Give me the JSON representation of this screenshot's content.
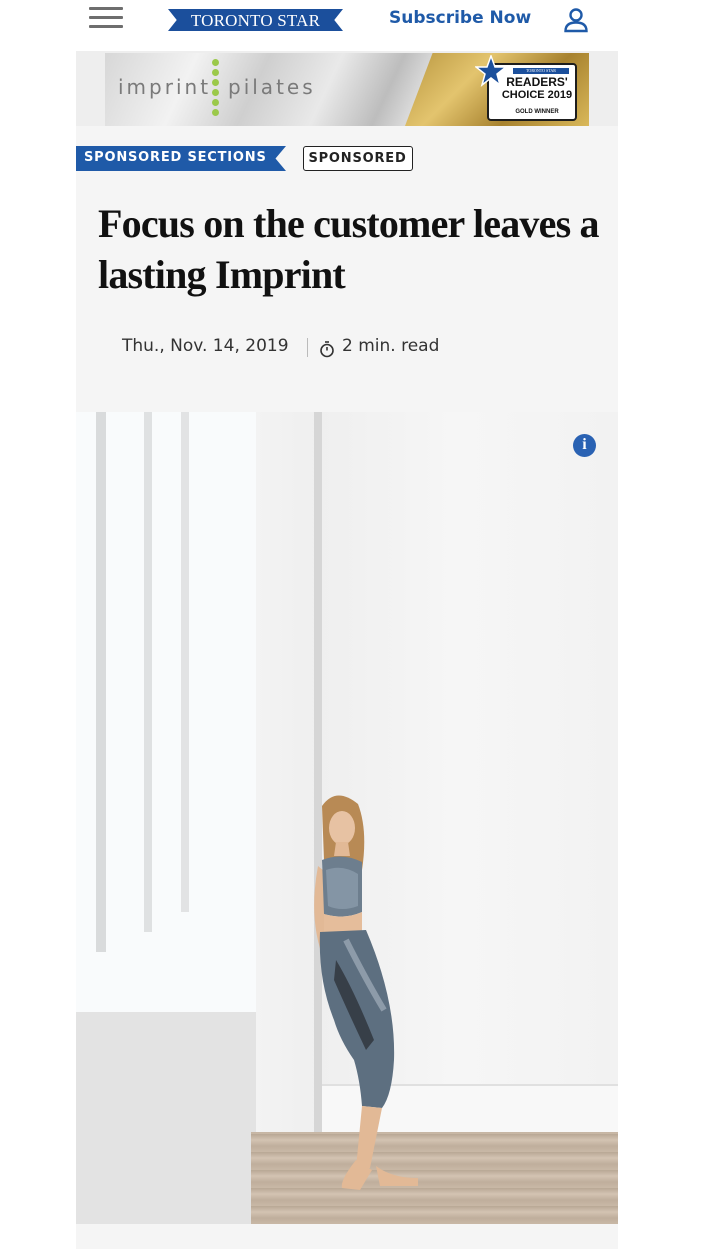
{
  "header": {
    "logo_text": "TORONTO STAR",
    "subscribe_label": "Subscribe Now",
    "menu_icon": "hamburger-menu-icon",
    "account_icon": "user-account-icon",
    "brand_color": "#1b4f9c",
    "link_color": "#1f5aa8"
  },
  "ad": {
    "brand_left": "imprint",
    "brand_right": "pilates",
    "badge_top": "TORONTO STAR",
    "badge_line1": "READERS'",
    "badge_line2": "CHOICE 2019",
    "badge_line3": "GOLD WINNER"
  },
  "article": {
    "section_label": "SPONSORED SECTIONS",
    "sponsored_label": "SPONSORED",
    "headline": "Focus on the customer leaves a lasting Imprint",
    "date": "Thu., Nov. 14, 2019",
    "read_time": "2 min. read",
    "clock_icon": "stopwatch-icon"
  },
  "photo": {
    "info_label": "i",
    "info_icon": "info-icon"
  }
}
